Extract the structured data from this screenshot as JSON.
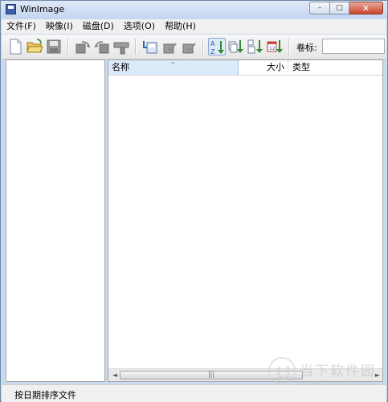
{
  "window": {
    "title": "WinImage"
  },
  "window_buttons": {
    "minimize": "–",
    "maximize": "□",
    "close": "✕"
  },
  "menu": [
    "文件(F)",
    "映像(I)",
    "磁盘(D)",
    "选项(O)",
    "帮助(H)"
  ],
  "toolbar": {
    "buttons": [
      {
        "icon": "new-file-icon"
      },
      {
        "icon": "open-folder-icon"
      },
      {
        "icon": "save-disk-icon"
      },
      {
        "icon": "read-disk-icon"
      },
      {
        "icon": "write-disk-icon"
      },
      {
        "icon": "format-icon"
      },
      {
        "icon": "extract-icon"
      },
      {
        "icon": "inject-icon"
      },
      {
        "icon": "delete-icon"
      },
      {
        "icon": "sort-by-name-icon"
      },
      {
        "icon": "sort-by-ext-icon"
      },
      {
        "icon": "sort-by-size-icon"
      },
      {
        "icon": "sort-by-date-icon"
      }
    ],
    "volume_label": "卷标:",
    "volume_value": ""
  },
  "file_list": {
    "columns": {
      "name": "名称",
      "size": "大小",
      "type": "类型"
    },
    "sort_indicator": "^",
    "rows": []
  },
  "scrollbar": {
    "left": "◄",
    "right": "►",
    "grip": "|||"
  },
  "status": {
    "text": "按日期排序文件"
  },
  "watermark": {
    "title": "当下软件园",
    "url": "www.downxia.com"
  }
}
